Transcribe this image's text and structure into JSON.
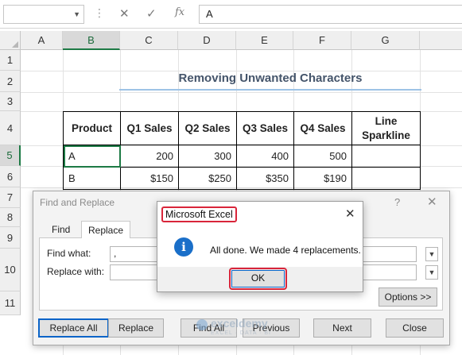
{
  "formula_bar": {
    "name_box": "",
    "cancel_glyph": "✕",
    "enter_glyph": "✓",
    "fx_glyph": "fx",
    "formula": "A"
  },
  "sheet": {
    "columns": [
      "A",
      "B",
      "C",
      "D",
      "E",
      "F",
      "G"
    ],
    "rows": [
      "1",
      "2",
      "3",
      "4",
      "5",
      "6",
      "7",
      "8",
      "9",
      "10",
      "11"
    ],
    "title": "Removing Unwanted Characters",
    "table": {
      "headers": [
        "Product",
        "Q1 Sales",
        "Q2 Sales",
        "Q3 Sales",
        "Q4 Sales",
        "Line Sparkline"
      ],
      "rows": [
        [
          "A",
          "200",
          "300",
          "400",
          "500",
          ""
        ],
        [
          "B",
          "$150",
          "$250",
          "$350",
          "$190",
          ""
        ]
      ]
    }
  },
  "find_replace": {
    "title": "Find and Replace",
    "help": "?",
    "close": "✕",
    "tabs": [
      "Find",
      "Replace"
    ],
    "find_label": "Find what:",
    "find_value": ",",
    "replace_label": "Replace with:",
    "replace_value": "",
    "options_button": "Options >>",
    "buttons": {
      "replace_all": "Replace All",
      "replace": "Replace",
      "find_all": "Find All",
      "previous": "Previous",
      "next": "Next",
      "close": "Close"
    }
  },
  "watermark": {
    "name": "exceldemy",
    "tagline": "EXCEL · DATA · BI"
  },
  "message_box": {
    "title": "Microsoft Excel",
    "close": "✕",
    "icon": "i",
    "message": "All done. We made 4 replacements.",
    "ok_label": "OK"
  }
}
